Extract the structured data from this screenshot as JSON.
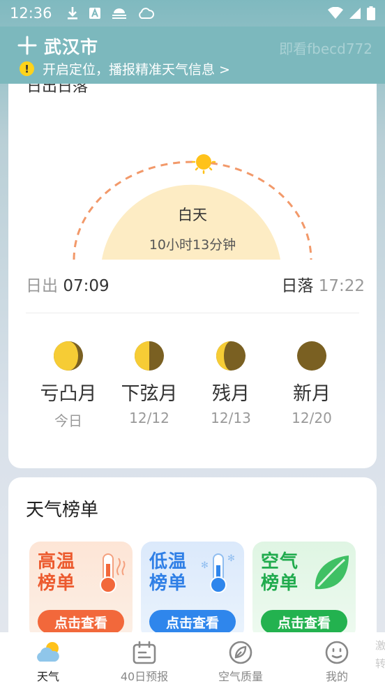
{
  "status_bar": {
    "time": "12:36"
  },
  "header": {
    "city": "武汉市",
    "watermark": "即看fbecd772",
    "location_tip": "开启定位，播报精准天气信息 >"
  },
  "sun_card": {
    "title_cut": "日出日落",
    "daytime_label": "白天",
    "daytime_duration": "10小时13分钟",
    "sunrise_label": "日出",
    "sunrise_time": "07:09",
    "sunset_label": "日落",
    "sunset_time": "17:22",
    "moon_phases": [
      {
        "name": "亏凸月",
        "date": "今日"
      },
      {
        "name": "下弦月",
        "date": "12/12"
      },
      {
        "name": "残月",
        "date": "12/13"
      },
      {
        "name": "新月",
        "date": "12/20"
      }
    ]
  },
  "rank_card": {
    "title": "天气榜单",
    "tiles": [
      {
        "line1": "高温",
        "line2": "榜单",
        "button": "点击查看"
      },
      {
        "line1": "低温",
        "line2": "榜单",
        "button": "点击查看"
      },
      {
        "line1": "空气",
        "line2": "榜单",
        "button": "点击查看"
      }
    ]
  },
  "bottom_nav": {
    "items": [
      {
        "label": "天气",
        "icon": "weather-icon",
        "active": true
      },
      {
        "label": "40日预报",
        "icon": "calendar-icon",
        "active": false
      },
      {
        "label": "空气质量",
        "icon": "leaf-icon",
        "active": false
      },
      {
        "label": "我的",
        "icon": "smiley-icon",
        "active": false
      }
    ],
    "peek_text": "激转"
  },
  "colors": {
    "header_bg": "#7cb8bd",
    "sun_fill": "#fdecc4",
    "arc_dash": "#f2996a",
    "hot": "#f2683b",
    "cold": "#2f86ec",
    "air": "#23b24f"
  }
}
